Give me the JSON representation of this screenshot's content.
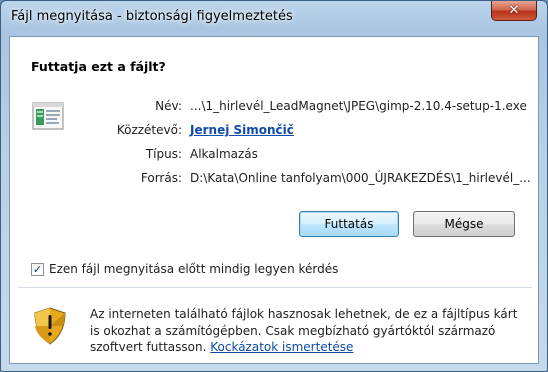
{
  "window": {
    "title": "Fájl megnyitása - biztonsági figyelmeztetés",
    "close_glyph": "✕"
  },
  "dialog": {
    "heading": "Futtatja ezt a fájlt?",
    "fields": {
      "name_label": "Név:",
      "name_value": "...\\1_hirlevél_LeadMagnet\\JPEG\\gimp-2.10.4-setup-1.exe",
      "publisher_label": "Közzétevő:",
      "publisher_value": "Jernej Simončič",
      "type_label": "Típus:",
      "type_value": "Alkalmazás",
      "source_label": "Forrás:",
      "source_value": "D:\\Kata\\Online tanfolyam\\000_ÚJRAKEZDÉS\\1_hirlevél_..."
    },
    "buttons": {
      "run": "Futtatás",
      "cancel": "Mégse"
    },
    "checkbox": {
      "label": "Ezen fájl megnyitása előtt mindig legyen kérdés",
      "checked": true,
      "mark": "✓"
    },
    "warning": {
      "text": "Az interneten található fájlok hasznosak lehetnek, de ez a fájltípus kárt is okozhat a számítógépben. Csak megbízható gyártóktól származó szoftvert futtasson.",
      "link": "Kockázatok ismertetése"
    }
  },
  "icons": {
    "file": "application-file-icon",
    "shield": "security-shield-icon",
    "close": "close-icon"
  },
  "colors": {
    "link": "#0f4aa8",
    "default_button_border": "#3c7fb1",
    "close_button": "#c7432a"
  }
}
